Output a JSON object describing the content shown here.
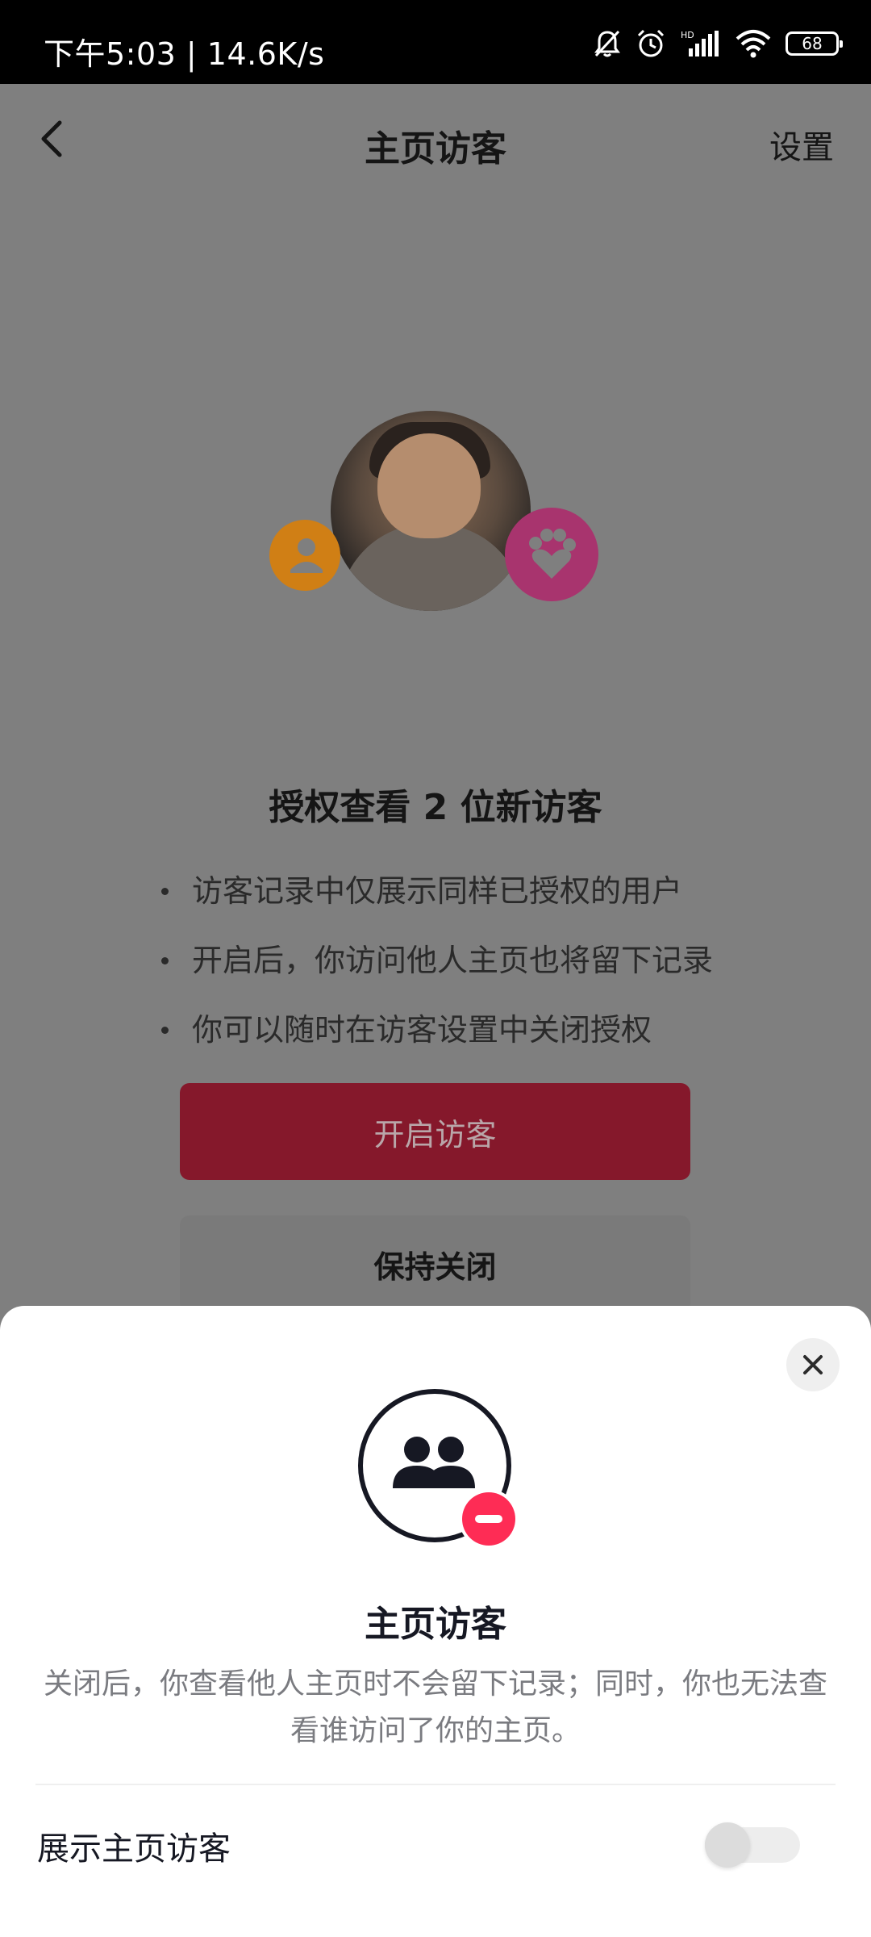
{
  "status_bar": {
    "time_and_speed": "下午5:03 | 14.6K/s",
    "battery": "68",
    "icons": [
      "mute-bell-icon",
      "alarm-icon",
      "hd-signal-icon",
      "wifi-icon",
      "battery-icon"
    ]
  },
  "nav": {
    "title": "主页访客",
    "settings_label": "设置"
  },
  "auth": {
    "title": "授权查看 2 位新访客",
    "bullets": [
      "访客记录中仅展示同样已授权的用户",
      "开启后，你访问他人主页也将留下记录",
      "你可以随时在访客设置中关闭授权"
    ],
    "primary_button": "开启访客",
    "secondary_button": "保持关闭"
  },
  "sheet": {
    "title": "主页访客",
    "description": "关闭后，你查看他人主页时不会留下记录；同时，你也无法查看谁访问了你的主页。",
    "toggle_label": "展示主页访客",
    "toggle_on": false
  },
  "colors": {
    "accent": "#fe2c55",
    "overlay": "#7f7f7f",
    "primary_button_dim": "#85182b"
  }
}
